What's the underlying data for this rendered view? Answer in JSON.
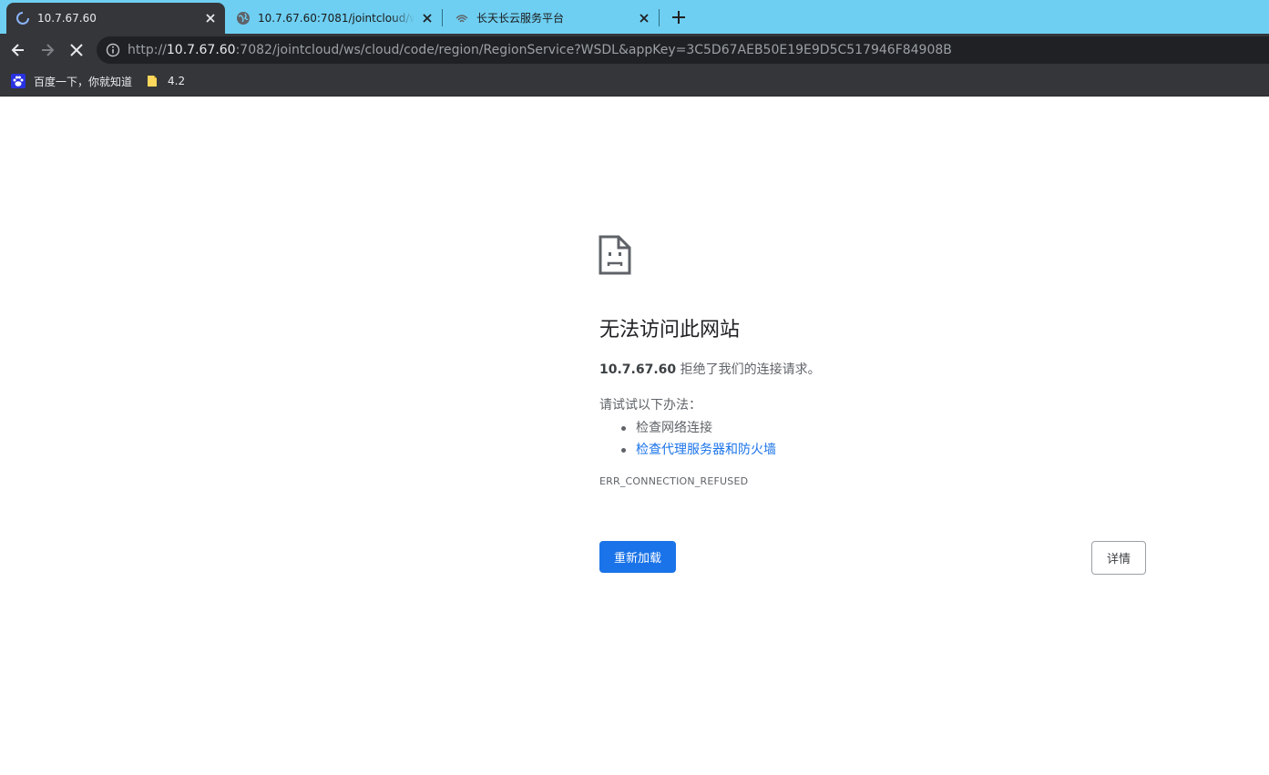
{
  "browser": {
    "tabs": [
      {
        "title": "10.7.67.60",
        "favicon": "loading-spinner-icon",
        "active": true
      },
      {
        "title": "10.7.67.60:7081/jointcloud/ws/",
        "favicon": "globe-icon",
        "active": false
      },
      {
        "title": "长天长云服务平台",
        "favicon": "site-logo-icon",
        "active": false
      }
    ],
    "colors": {
      "tabstrip": "#6ecff2",
      "toolbar": "#35363a",
      "omnibox": "#202124"
    }
  },
  "omnibox": {
    "url_scheme": "http://",
    "url_host": "10.7.67.60",
    "url_rest": ":7082/jointcloud/ws/cloud/code/region/RegionService?WSDL&appKey=3C5D67AEB50E19E9D5C517946F84908B"
  },
  "bookmarks": [
    {
      "label": "百度一下，你就知道",
      "icon": "baidu-paw-icon"
    },
    {
      "label": "4.2",
      "icon": "folder-icon"
    }
  ],
  "error_page": {
    "icon": "sad-document-icon",
    "title": "无法访问此网站",
    "host": "10.7.67.60",
    "summary_suffix": " 拒绝了我们的连接请求。",
    "try_heading": "请试试以下办法：",
    "suggestions": [
      "检查网络连接",
      "检查代理服务器和防火墙"
    ],
    "error_code": "ERR_CONNECTION_REFUSED",
    "reload_label": "重新加载",
    "details_label": "详情",
    "colors": {
      "primary_button": "#1a73e8",
      "link": "#1a73e8",
      "text": "#5f6368"
    }
  }
}
